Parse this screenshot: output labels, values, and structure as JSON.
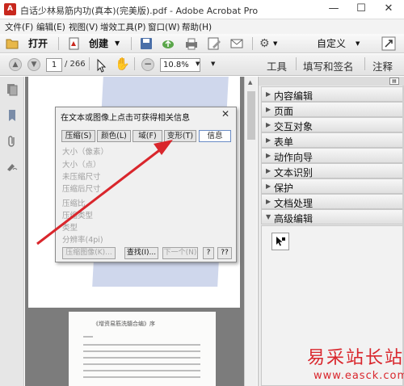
{
  "window": {
    "app_icon": "acrobat-icon",
    "title": "白话少林易筋内功(真本)(完美版).pdf - Adobe Acrobat Pro",
    "minimize": "—",
    "maximize": "☐",
    "close": "✕"
  },
  "menubar": [
    "文件(F)",
    "编辑(E)",
    "视图(V)",
    "增效工具(P)",
    "窗口(W)",
    "帮助(H)"
  ],
  "toolbar": {
    "open_label": "打开",
    "create_label": "创建",
    "customize_label": "自定义",
    "icons": [
      "folder-open-icon",
      "create-pdf-icon",
      "save-icon",
      "cloud-upload-icon",
      "print-icon",
      "edit-icon",
      "email-icon",
      "settings-icon",
      "expand-icon"
    ]
  },
  "navbar": {
    "current_page": "1",
    "total_pages": "/ 266",
    "zoom": "10.8%",
    "tabs": [
      "工具",
      "填写和签名",
      "注释"
    ]
  },
  "dialog": {
    "title": "在文本或图像上点击可获得相关信息",
    "close": "✕",
    "tabs": [
      "压缩(S)",
      "颜色(L)",
      "域(F)",
      "变形(T)",
      "信息"
    ],
    "active_tab": "信息",
    "fields": [
      "大小（像素）",
      "大小（点）",
      "未压缩尺寸",
      "压缩后尺寸",
      "压缩比",
      "压缩类型",
      "类型",
      "分辨率(4pi)"
    ],
    "buttons": [
      "压缩图像(K)...",
      "查找(I)...",
      "下一个(N)",
      "?",
      "??"
    ]
  },
  "doc_page2": {
    "title": "《增资易筋洗髓合编》序"
  },
  "tool_pane": {
    "items": [
      "内容编辑",
      "页面",
      "交互对象",
      "表单",
      "动作向导",
      "文本识别",
      "保护",
      "文档处理",
      "高级编辑"
    ],
    "expanded_item": "高级编辑",
    "expanded_tool_icon": "touchup-object-tool-icon"
  },
  "watermark": {
    "text": "易采站长站",
    "url": "www.easck.com"
  },
  "annotation": {
    "arrow_color": "#d9262c"
  }
}
